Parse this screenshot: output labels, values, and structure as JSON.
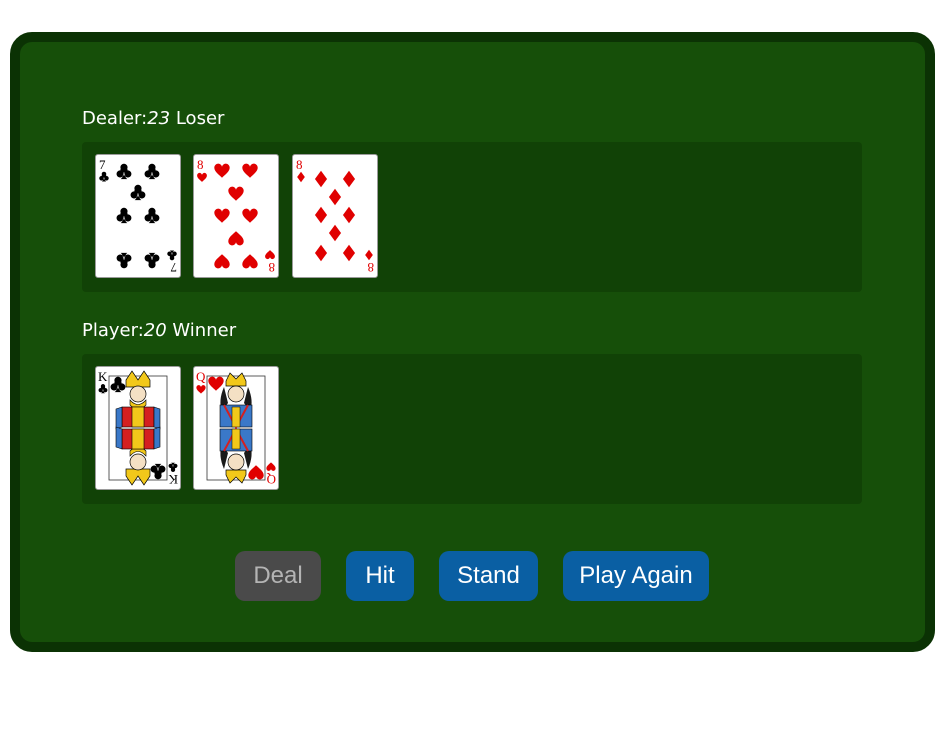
{
  "colors": {
    "felt": "#164f09",
    "felt_border": "#0b3204",
    "hand_area": "#114206",
    "button_active": "#0a5fa3",
    "button_disabled": "#4a4a4a",
    "button_disabled_text": "#b4b4b4",
    "suit_red": "#e00000",
    "suit_black": "#000000"
  },
  "dealer": {
    "label": "Dealer:",
    "score": "23",
    "result": "Loser",
    "cards": [
      {
        "rank": "7",
        "suit": "clubs",
        "icon": "club-icon",
        "color": "#000000"
      },
      {
        "rank": "8",
        "suit": "hearts",
        "icon": "heart-icon",
        "color": "#e00000"
      },
      {
        "rank": "8",
        "suit": "diamonds",
        "icon": "diamond-icon",
        "color": "#e00000"
      }
    ]
  },
  "player": {
    "label": "Player:",
    "score": "20",
    "result": "Winner",
    "cards": [
      {
        "rank": "K",
        "suit": "clubs",
        "icon": "club-icon",
        "color": "#000000",
        "face": "king"
      },
      {
        "rank": "Q",
        "suit": "hearts",
        "icon": "heart-icon",
        "color": "#e00000",
        "face": "queen"
      }
    ]
  },
  "buttons": {
    "deal": "Deal",
    "hit": "Hit",
    "stand": "Stand",
    "play_again": "Play Again"
  }
}
